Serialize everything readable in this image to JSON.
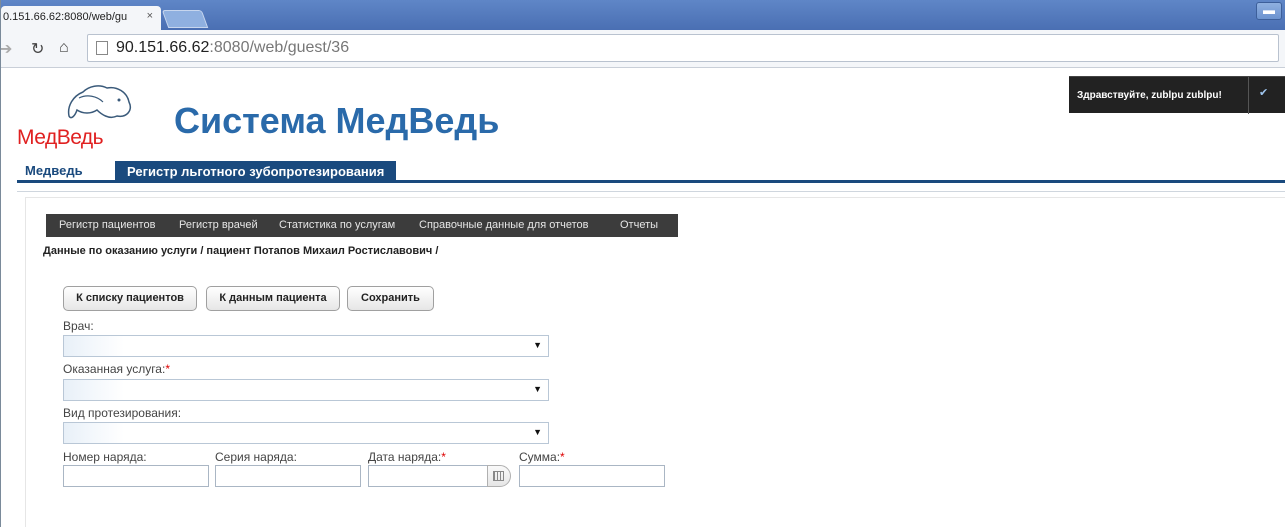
{
  "browser": {
    "tab_title": "0.151.66.62:8080/web/gu",
    "tab_close": "×",
    "url_host": "90.151.66.62",
    "url_path": ":8080/web/guest/36"
  },
  "header": {
    "logo_text_main": "МедВедь",
    "site_title": "Система МедВедь",
    "greeting": "Здравствуйте, zublpu zublpu!"
  },
  "nav_tabs": [
    {
      "label": "Медведь"
    },
    {
      "label": "Регистр льготного зубопротезирования"
    }
  ],
  "menu": [
    {
      "label": "Регистр пациентов"
    },
    {
      "label": "Регистр врачей"
    },
    {
      "label": "Статистика по услугам"
    },
    {
      "label": "Справочные данные для отчетов"
    },
    {
      "label": "Отчеты"
    }
  ],
  "breadcrumb": "Данные по оказанию услуги / пациент Потапов Михаил Ростиславович /",
  "buttons": {
    "to_patients": "К списку пациентов",
    "to_patient_data": "К данным пациента",
    "save": "Сохранить"
  },
  "form": {
    "doctor_label": "Врач:",
    "service_label": "Оказанная услуга:",
    "prosthetics_label": "Вид протезирования:",
    "order_number_label": "Номер наряда:",
    "order_series_label": "Серия наряда:",
    "order_date_label": "Дата наряда:",
    "sum_label": "Сумма:",
    "required_mark": "*"
  },
  "colors": {
    "title_blue": "#2a6aaa",
    "nav_dark": "#1a4a7e",
    "menubar": "#3c3c3c",
    "logo_red": "#e02020"
  }
}
